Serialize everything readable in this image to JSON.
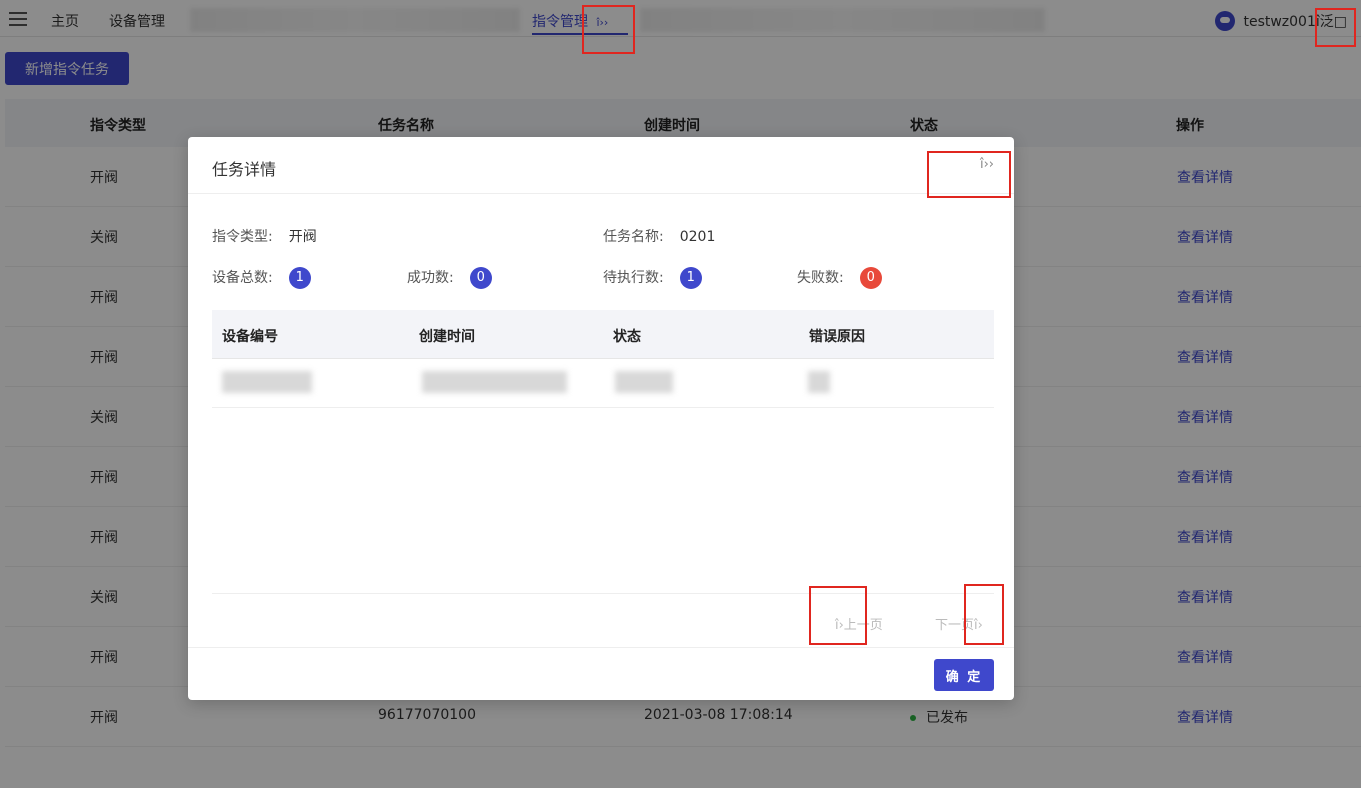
{
  "nav": {
    "home": "主页",
    "device_mgmt": "设备管理",
    "command_mgmt": "指令管理",
    "command_mgmt_icon": "î››",
    "user": "testwz001î泛□"
  },
  "toolbar": {
    "new_task": "新增指令任务"
  },
  "table": {
    "headers": [
      "指令类型",
      "任务名称",
      "创建时间",
      "状态",
      "操作"
    ],
    "rows": [
      {
        "type": "开阀",
        "action": "查看详情"
      },
      {
        "type": "关阀",
        "action": "查看详情"
      },
      {
        "type": "开阀",
        "action": "查看详情"
      },
      {
        "type": "开阀",
        "action": "查看详情"
      },
      {
        "type": "关阀",
        "action": "查看详情"
      },
      {
        "type": "开阀",
        "action": "查看详情"
      },
      {
        "type": "开阀",
        "action": "查看详情"
      },
      {
        "type": "关阀",
        "action": "查看详情"
      },
      {
        "type": "开阀",
        "action": "查看详情"
      },
      {
        "type": "开阀",
        "name": "96177070100",
        "time": "2021-03-08 17:08:14",
        "status": "已发布",
        "action": "查看详情"
      }
    ]
  },
  "modal": {
    "title": "任务详情",
    "close": "î››",
    "cmd_type_label": "指令类型:",
    "cmd_type_value": "开阀",
    "task_name_label": "任务名称:",
    "task_name_value": "0201",
    "total_label": "设备总数:",
    "total_value": "1",
    "success_label": "成功数:",
    "success_value": "0",
    "pending_label": "待执行数:",
    "pending_value": "1",
    "fail_label": "失败数:",
    "fail_value": "0",
    "table_headers": [
      "设备编号",
      "创建时间",
      "状态",
      "错误原因"
    ],
    "prev": "î›上一页",
    "next": "下一页î›",
    "confirm": "确 定"
  },
  "colors": {
    "accent": "#3f48cc",
    "danger": "#e8493a",
    "success": "#2fb344"
  }
}
